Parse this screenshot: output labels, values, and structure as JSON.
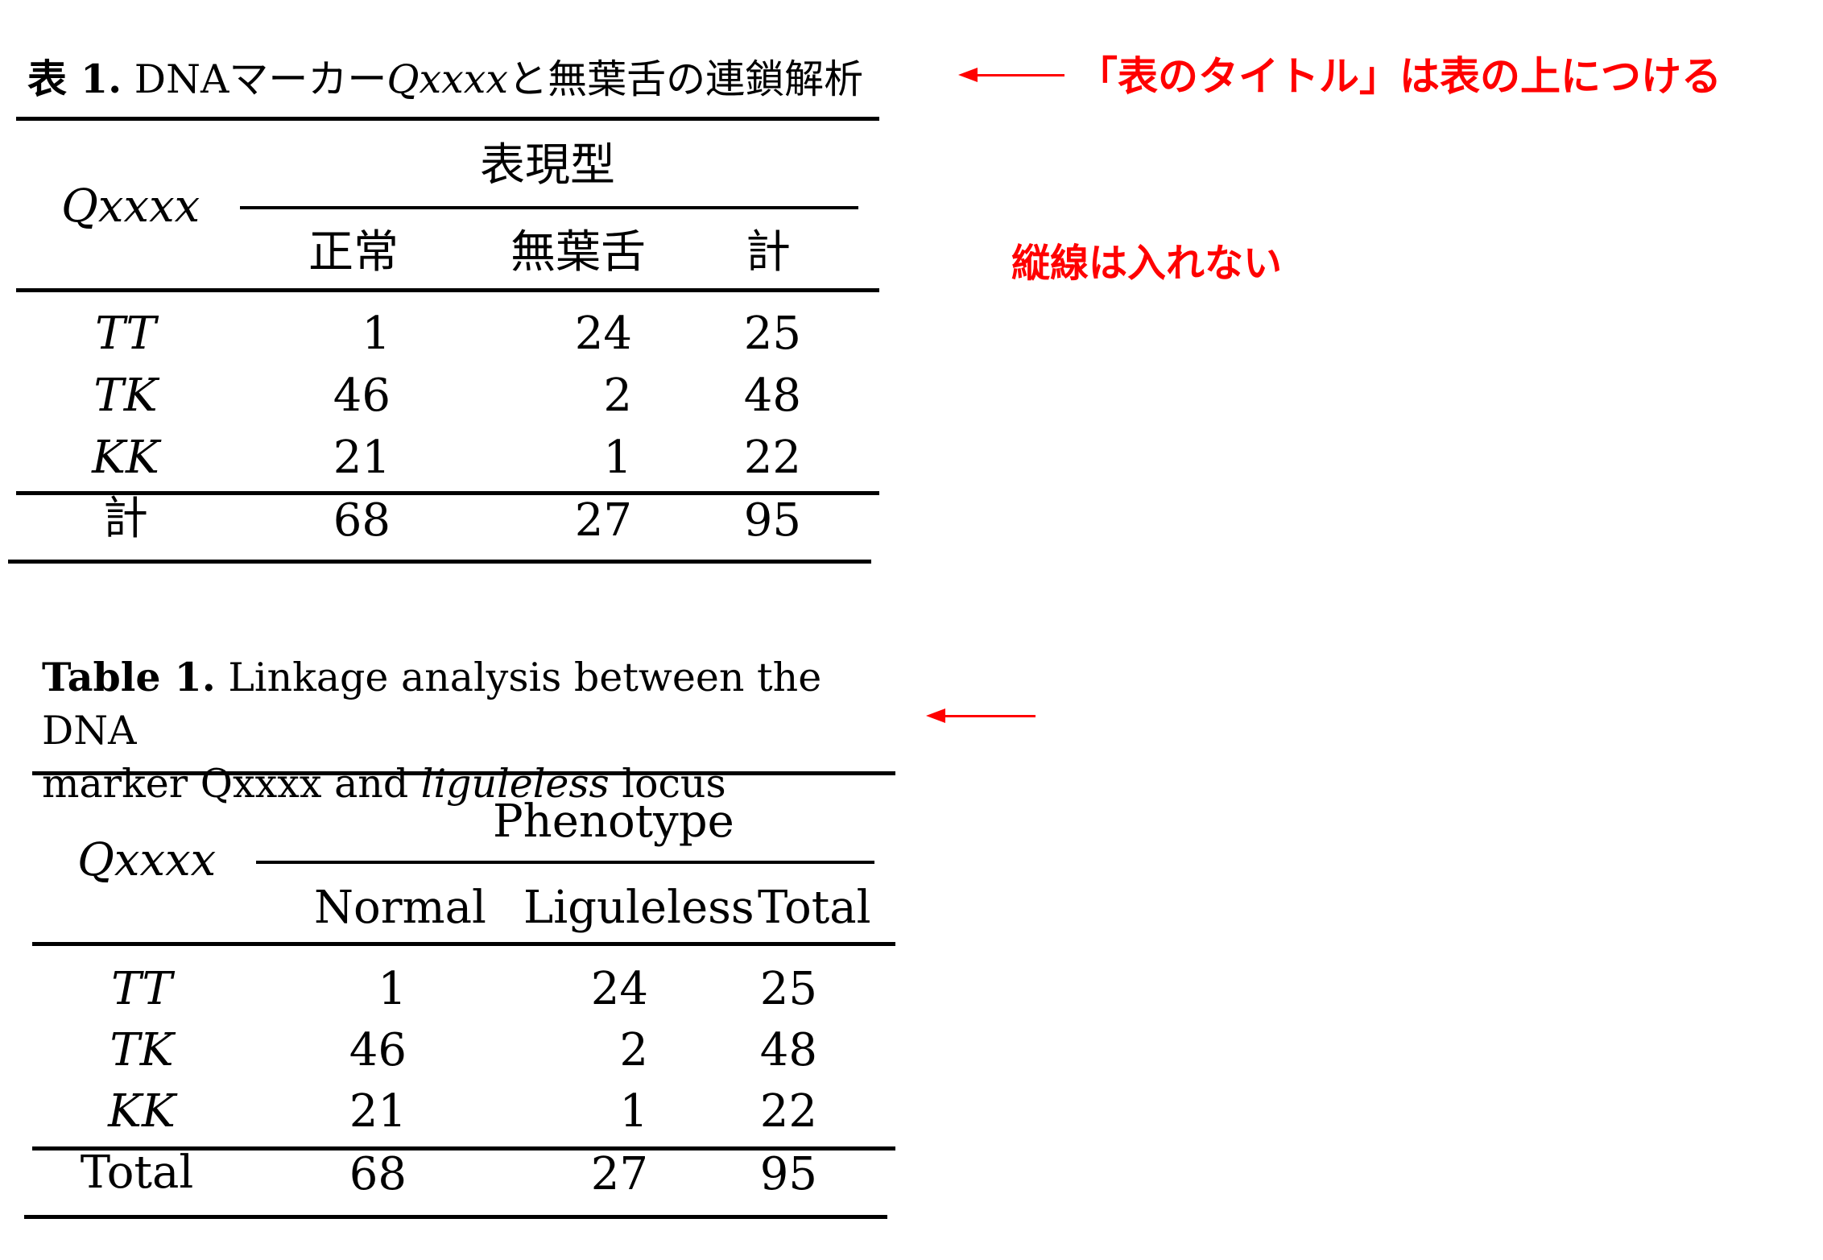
{
  "ja": {
    "caption_num": "表 1.",
    "caption_pre": "DNAマーカー",
    "caption_marker": "Qxxxx",
    "caption_post": "と無葉舌の連鎖解析",
    "row_header": "Qxxxx",
    "phenotype": "表現型",
    "col_normal": "正常",
    "col_liguleless": "無葉舌",
    "col_total": "計",
    "rows": [
      {
        "label": "TT",
        "normal": "1",
        "liguleless": "24",
        "total": "25"
      },
      {
        "label": "TK",
        "normal": "46",
        "liguleless": "2",
        "total": "48"
      },
      {
        "label": "KK",
        "normal": "21",
        "liguleless": "1",
        "total": "22"
      }
    ],
    "total_row": {
      "label": "計",
      "normal": "68",
      "liguleless": "27",
      "total": "95"
    }
  },
  "en": {
    "caption_num": "Table 1.",
    "caption_line1": "Linkage analysis between the DNA",
    "caption_line2_pre": "marker Qxxxx and",
    "caption_line2_it": "liguleless",
    "caption_line2_post": "locus",
    "row_header": "Qxxxx",
    "phenotype": "Phenotype",
    "col_normal": "Normal",
    "col_liguleless": "Liguleless",
    "col_total": "Total",
    "rows": [
      {
        "label": "TT",
        "normal": "1",
        "liguleless": "24",
        "total": "25"
      },
      {
        "label": "TK",
        "normal": "46",
        "liguleless": "2",
        "total": "48"
      },
      {
        "label": "KK",
        "normal": "21",
        "liguleless": "1",
        "total": "22"
      }
    ],
    "total_row": {
      "label": "Total",
      "normal": "68",
      "liguleless": "27",
      "total": "95"
    }
  },
  "notes": {
    "title_position": "「表のタイトル」は表の上につける",
    "no_vertical_lines": "縦線は入れない"
  },
  "colors": {
    "annotation": "#ff0000",
    "text": "#000000"
  },
  "icons": [
    "left-arrow-icon"
  ]
}
